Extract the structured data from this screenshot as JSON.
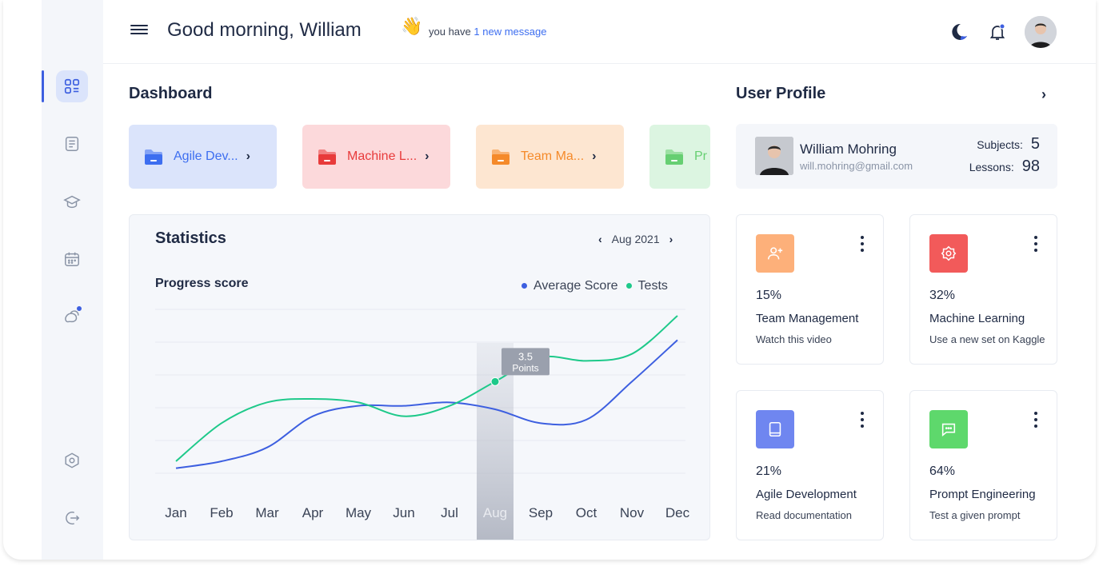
{
  "header": {
    "greeting": "Good morning, William",
    "wave_emoji": "👋",
    "message_prefix": "you have",
    "message_link": "1 new message",
    "icons": [
      "menu-icon",
      "moon-icon",
      "bell-icon",
      "avatar"
    ]
  },
  "sidebar": {
    "items": [
      {
        "icon": "dashboard-icon",
        "active": true
      },
      {
        "icon": "document-icon",
        "active": false
      },
      {
        "icon": "graduation-cap-icon",
        "active": false
      },
      {
        "icon": "calendar-icon",
        "active": false
      },
      {
        "icon": "chat-icon",
        "active": false,
        "badge": true
      },
      {
        "icon": "settings-icon",
        "active": false
      },
      {
        "icon": "logout-icon",
        "active": false
      }
    ]
  },
  "dashboard": {
    "title": "Dashboard",
    "courses": [
      {
        "name": "Agile Dev...",
        "bg": "#dbe4fb",
        "color": "#3d6ef0"
      },
      {
        "name": "Machine L...",
        "bg": "#fcd9db",
        "color": "#e83b3b"
      },
      {
        "name": "Team Ma...",
        "bg": "#fde6d1",
        "color": "#f58a2a"
      },
      {
        "name": "Pr",
        "bg": "#d7f4dc",
        "color": "#4cc75a"
      }
    ]
  },
  "statistics": {
    "title": "Statistics",
    "month": "Aug 2021",
    "progress_label": "Progress score",
    "legend": [
      {
        "name": "Average Score",
        "color": "#3d5fe0"
      },
      {
        "name": "Tests",
        "color": "#1ec98a"
      }
    ],
    "tooltip_value": "3.5",
    "tooltip_unit": "Points",
    "highlight_month": "Aug"
  },
  "chart_data": {
    "type": "line",
    "title": "Progress score",
    "categories": [
      "Jan",
      "Feb",
      "Mar",
      "Apr",
      "May",
      "Jun",
      "Jul",
      "Aug",
      "Sep",
      "Oct",
      "Nov",
      "Dec"
    ],
    "series": [
      {
        "name": "Average Score",
        "values": [
          1.0,
          1.2,
          1.6,
          2.5,
          2.8,
          2.8,
          2.9,
          2.7,
          2.3,
          2.4,
          3.5,
          4.7
        ]
      },
      {
        "name": "Tests",
        "values": [
          1.2,
          2.3,
          2.9,
          3.0,
          2.9,
          2.5,
          2.8,
          3.5,
          4.2,
          4.1,
          4.3,
          5.4
        ]
      }
    ],
    "ylim": [
      0,
      6
    ],
    "grid": true,
    "legend_position": "top-right"
  },
  "profile": {
    "title": "User Profile",
    "name": "William Mohring",
    "email": "will.mohring@gmail.com",
    "subjects_label": "Subjects:",
    "subjects": "5",
    "lessons_label": "Lessons:",
    "lessons": "98"
  },
  "tasks": [
    {
      "percent": "15%",
      "title": "Team Management",
      "subtitle": "Watch this video",
      "color": "#fdb07a",
      "icon": "add-user-icon"
    },
    {
      "percent": "32%",
      "title": "Machine Learning",
      "subtitle": "Use a new set on Kaggle",
      "color": "#f25a5a",
      "icon": "gear-flower-icon"
    },
    {
      "percent": "21%",
      "title": "Agile Development",
      "subtitle": "Read documentation",
      "color": "#6f86f0",
      "icon": "book-icon"
    },
    {
      "percent": "64%",
      "title": "Prompt Engineering",
      "subtitle": "Test a given prompt",
      "color": "#5ed86c",
      "icon": "message-icon"
    }
  ]
}
